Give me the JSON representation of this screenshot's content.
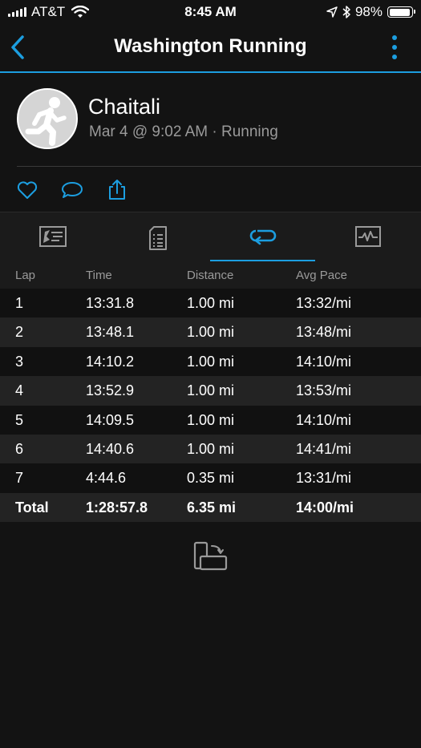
{
  "status_bar": {
    "carrier": "AT&T",
    "time": "8:45 AM",
    "battery": "98%",
    "battery_level": 0.98
  },
  "nav": {
    "title": "Washington Running",
    "back_icon": "chevron-left-icon",
    "more_icon": "vertical-dots-icon",
    "accent_color": "#1c9ee0"
  },
  "profile": {
    "name": "Chaitali",
    "meta": "Mar 4 @ 9:02 AM · Running",
    "avatar_icon": "runner-icon"
  },
  "actions": [
    {
      "name": "like-icon"
    },
    {
      "name": "comment-icon"
    },
    {
      "name": "share-icon"
    }
  ],
  "tabs": [
    {
      "name": "summary-tab-icon",
      "active": false
    },
    {
      "name": "stats-tab-icon",
      "active": false
    },
    {
      "name": "laps-tab-icon",
      "active": true
    },
    {
      "name": "charts-tab-icon",
      "active": false
    }
  ],
  "laps": {
    "headers": [
      "Lap",
      "Time",
      "Distance",
      "Avg Pace"
    ],
    "rows": [
      [
        "1",
        "13:31.8",
        "1.00 mi",
        "13:32/mi"
      ],
      [
        "2",
        "13:48.1",
        "1.00 mi",
        "13:48/mi"
      ],
      [
        "3",
        "14:10.2",
        "1.00 mi",
        "14:10/mi"
      ],
      [
        "4",
        "13:52.9",
        "1.00 mi",
        "13:53/mi"
      ],
      [
        "5",
        "14:09.5",
        "1.00 mi",
        "14:10/mi"
      ],
      [
        "6",
        "14:40.6",
        "1.00 mi",
        "14:41/mi"
      ],
      [
        "7",
        "4:44.6",
        "0.35 mi",
        "13:31/mi"
      ]
    ],
    "total": [
      "Total",
      "1:28:57.8",
      "6.35 mi",
      "14:00/mi"
    ]
  },
  "rotate_icon": "rotate-device-icon"
}
